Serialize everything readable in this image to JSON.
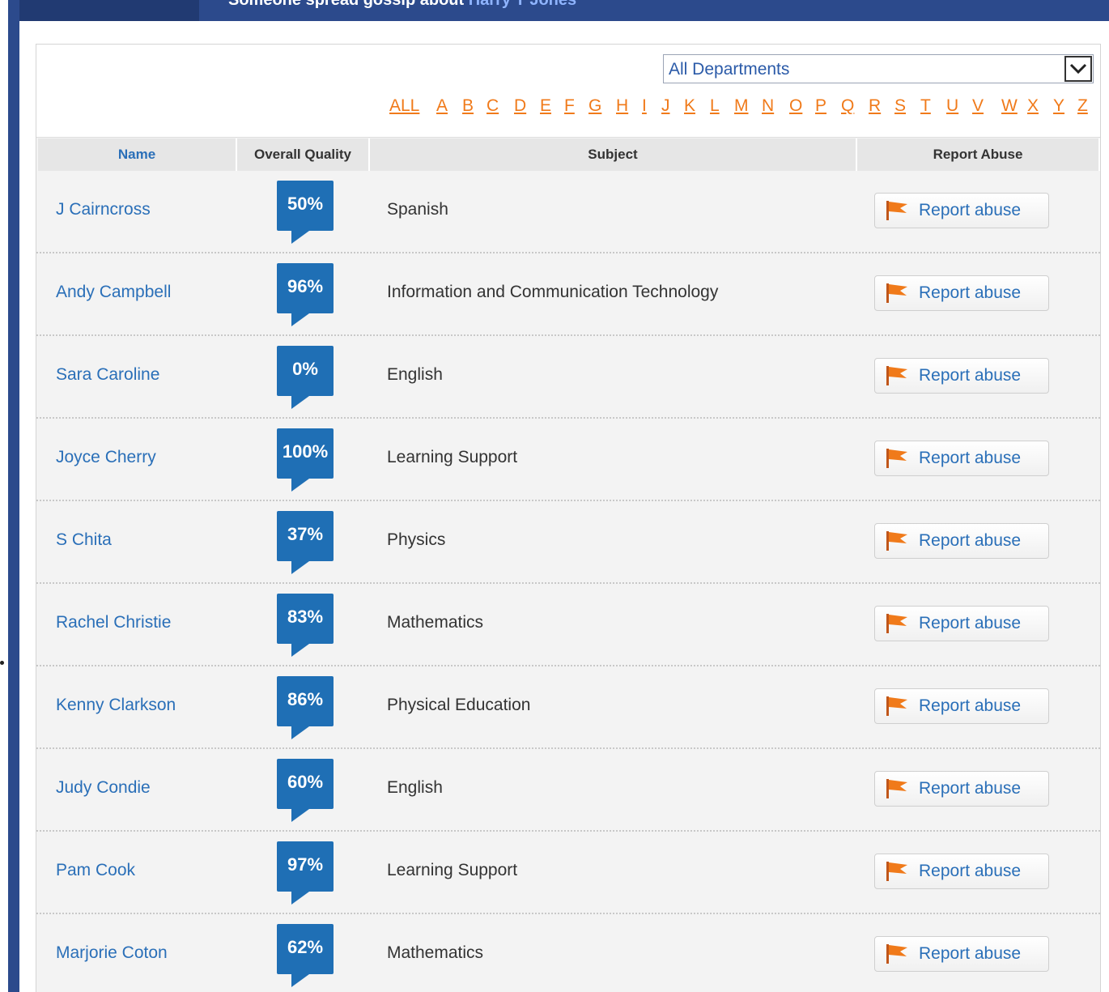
{
  "header": {
    "gossip_prefix": "Someone spread gossip about",
    "gossip_name": "Harry T Jones"
  },
  "filter": {
    "department": "All Departments",
    "letters": [
      "ALL",
      "A",
      "B",
      "C",
      "D",
      "E",
      "F",
      "G",
      "H",
      "I",
      "J",
      "K",
      "L",
      "M",
      "N",
      "O",
      "P",
      "Q",
      "R",
      "S",
      "T",
      "U",
      "V",
      "W",
      "X",
      "Y",
      "Z"
    ]
  },
  "table": {
    "columns": [
      "Name",
      "Overall Quality",
      "Subject",
      "Report Abuse"
    ],
    "report_label": "Report abuse",
    "rows": [
      {
        "name": "J Cairncross",
        "quality": "50%",
        "subject": "Spanish"
      },
      {
        "name": "Andy Campbell",
        "quality": "96%",
        "subject": "Information and Communication Technology"
      },
      {
        "name": "Sara Caroline",
        "quality": "0%",
        "subject": "English"
      },
      {
        "name": "Joyce Cherry",
        "quality": "100%",
        "subject": "Learning Support"
      },
      {
        "name": "S Chita",
        "quality": "37%",
        "subject": "Physics"
      },
      {
        "name": "Rachel Christie",
        "quality": "83%",
        "subject": "Mathematics"
      },
      {
        "name": "Kenny Clarkson",
        "quality": "86%",
        "subject": "Physical Education"
      },
      {
        "name": "Judy Condie",
        "quality": "60%",
        "subject": "English"
      },
      {
        "name": "Pam Cook",
        "quality": "97%",
        "subject": "Learning Support"
      },
      {
        "name": "Marjorie Coton",
        "quality": "62%",
        "subject": "Mathematics"
      }
    ]
  },
  "colors": {
    "accent_blue": "#1f6fb5",
    "link_blue": "#2a6fb8",
    "letter_orange": "#f07a1a",
    "flag_orange": "#f07a1a",
    "topbar": "#2c4a8c"
  },
  "icons": {
    "dropdown": "chevron-down-icon",
    "flag": "flag-icon"
  }
}
